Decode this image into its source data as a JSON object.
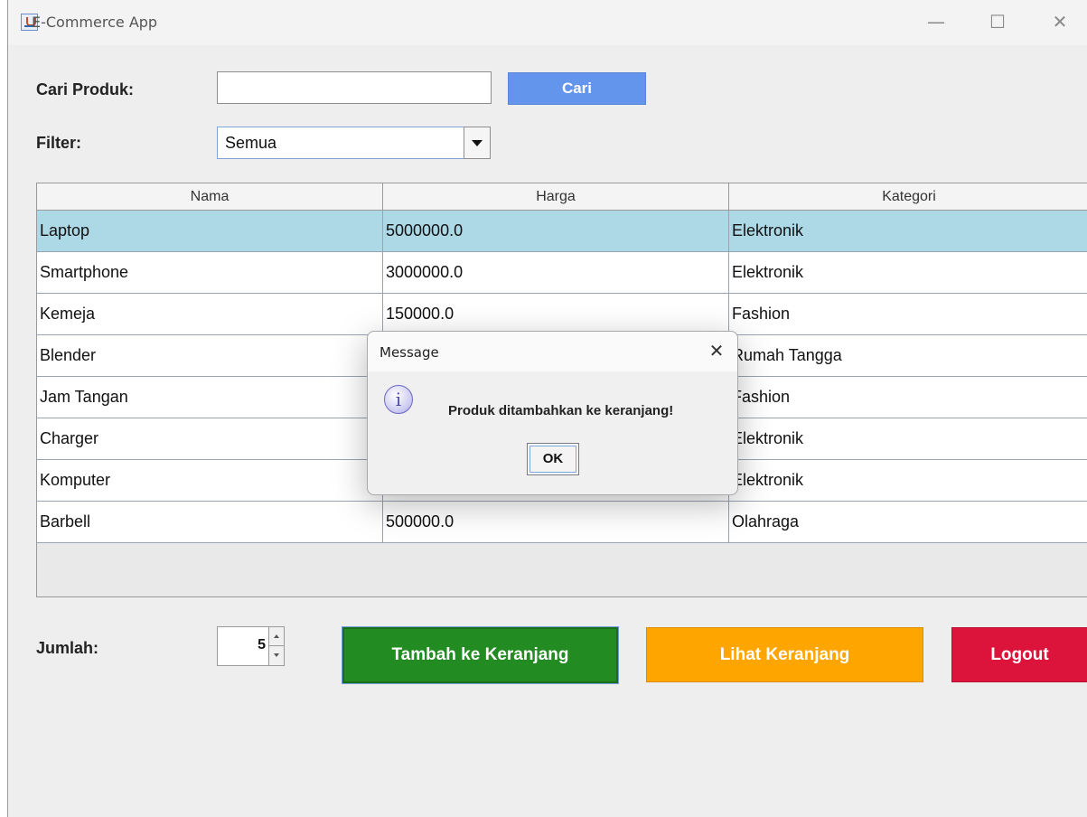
{
  "window": {
    "title": "E-Commerce App",
    "minimize": "—",
    "maximize": "☐",
    "close": "✕"
  },
  "search": {
    "label": "Cari Produk:",
    "value": "",
    "button": "Cari"
  },
  "filter": {
    "label": "Filter:",
    "selected": "Semua"
  },
  "table": {
    "columns": [
      "Nama",
      "Harga",
      "Kategori"
    ],
    "rows": [
      [
        "Laptop",
        "5000000.0",
        "Elektronik"
      ],
      [
        "Smartphone",
        "3000000.0",
        "Elektronik"
      ],
      [
        "Kemeja",
        "150000.0",
        "Fashion"
      ],
      [
        "Blender",
        "",
        "Rumah Tangga"
      ],
      [
        "Jam Tangan",
        "",
        "Fashion"
      ],
      [
        "Charger",
        "",
        "Elektronik"
      ],
      [
        "Komputer",
        "",
        "Elektronik"
      ],
      [
        "Barbell",
        "500000.0",
        "Olahraga"
      ]
    ]
  },
  "quantity": {
    "label": "Jumlah:",
    "value": "5"
  },
  "actions": {
    "add_to_cart": "Tambah ke Keranjang",
    "view_cart": "Lihat Keranjang",
    "logout": "Logout"
  },
  "dialog": {
    "title": "Message",
    "close": "✕",
    "icon": "i",
    "message": "Produk ditambahkan ke keranjang!",
    "ok": "OK"
  },
  "colors": {
    "search_button": "#6495ed",
    "selected_row": "#add8e6",
    "add_button": "#228b22",
    "cart_button": "#ffa500",
    "logout_button": "#dc143c"
  }
}
